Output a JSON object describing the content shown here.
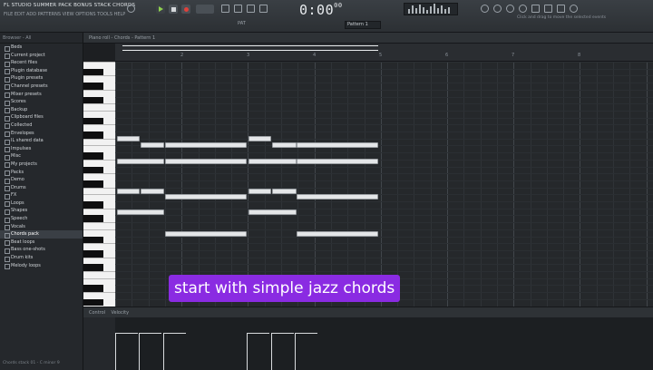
{
  "toolbar": {
    "title": "FL STUDIO SUMMER PACK BONUS STACK CHORDS",
    "menu": "FILE EDIT ADD PATTERNS VIEW OPTIONS TOOLS HELP",
    "time": "0:00",
    "time_suffix": "00",
    "pattern": "Pattern 1",
    "hint": "Click and drag to move the selected events"
  },
  "browser": {
    "header": "Browser - All",
    "items": [
      "Beds",
      "Current project",
      "Recent files",
      "Plugin database",
      "Plugin presets",
      "Channel presets",
      "Mixer presets",
      "Scores",
      "Backup",
      "Clipboard files",
      "Collected",
      "Envelopes",
      "IL shared data",
      "Impulses",
      "Misc",
      "My projects",
      "Packs",
      "Demo",
      "Drums",
      "FX",
      "Loops",
      "Shapes",
      "Speech",
      "Vocals",
      "Chords pack",
      "Beat loops",
      "Bass one-shots",
      "Drum kits",
      "Melody loops"
    ],
    "selected_index": 24,
    "footer": "Chords stack 01 - C minor 9"
  },
  "piano_roll": {
    "title": "Piano roll - Chords - Pattern 1",
    "ruler_ticks": [
      "2",
      "3",
      "4",
      "5",
      "6",
      "7",
      "8"
    ]
  },
  "event_editor": {
    "label": "Control",
    "param": "Velocity"
  },
  "caption": "start with simple jazz chords",
  "colors": {
    "caption_bg": "#8a2be2",
    "note": "#e4e6e8",
    "grid": "#25282b"
  }
}
